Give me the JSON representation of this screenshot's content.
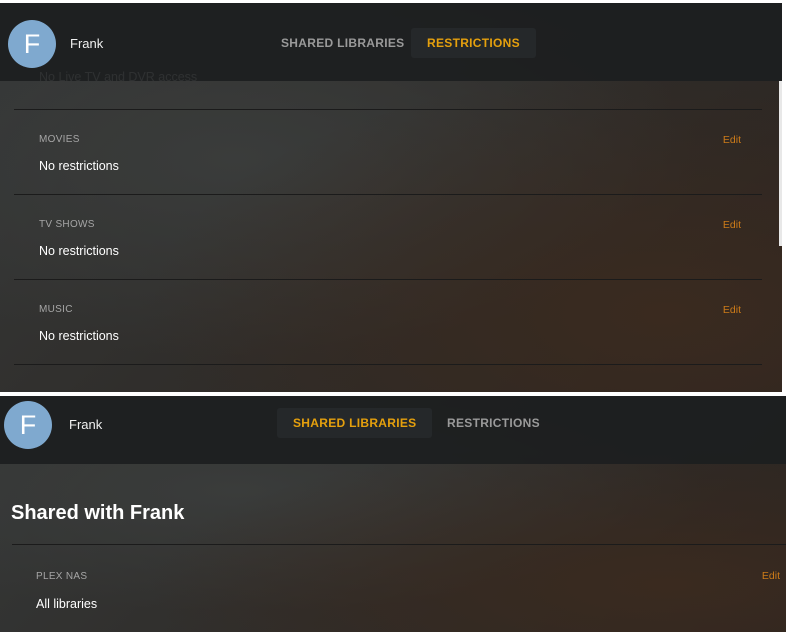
{
  "restrictions_view": {
    "user": {
      "avatar_letter": "F",
      "name": "Frank"
    },
    "tabs": {
      "shared_libraries": "SHARED LIBRARIES",
      "restrictions": "RESTRICTIONS",
      "active": "restrictions"
    },
    "partial_text": "No Live TV and DVR access",
    "sections": [
      {
        "label": "MOVIES",
        "value": "No restrictions",
        "edit": "Edit"
      },
      {
        "label": "TV SHOWS",
        "value": "No restrictions",
        "edit": "Edit"
      },
      {
        "label": "MUSIC",
        "value": "No restrictions",
        "edit": "Edit"
      }
    ]
  },
  "shared_view": {
    "user": {
      "avatar_letter": "F",
      "name": "Frank"
    },
    "tabs": {
      "shared_libraries": "SHARED LIBRARIES",
      "restrictions": "RESTRICTIONS",
      "active": "shared_libraries"
    },
    "title": "Shared with Frank",
    "servers": [
      {
        "label": "PLEX NAS",
        "value": "All libraries",
        "edit": "Edit"
      }
    ]
  },
  "colors": {
    "accent": "#e5a00d",
    "edit": "#cc7b19",
    "avatar": "#7fa9cf"
  }
}
